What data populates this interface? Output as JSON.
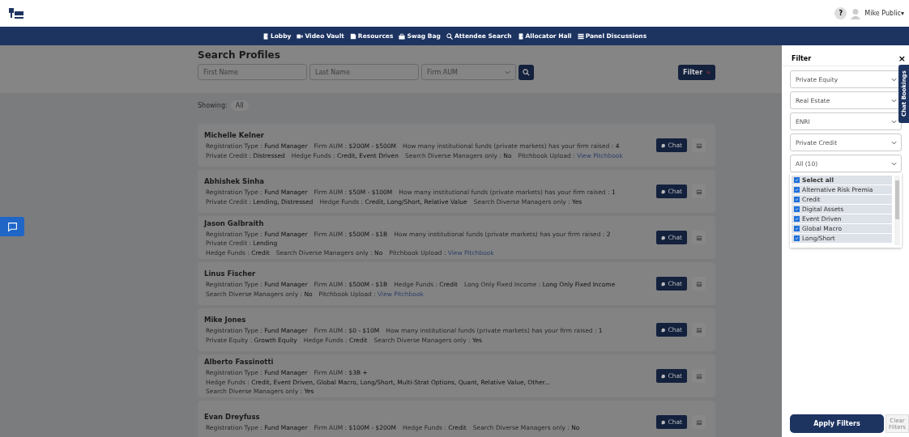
{
  "header": {
    "user_name": "Mike Public▾",
    "help": "?"
  },
  "nav": [
    {
      "label": "Lobby"
    },
    {
      "label": "Video Vault"
    },
    {
      "label": "Resources"
    },
    {
      "label": "Swag Bag"
    },
    {
      "label": "Attendee Search"
    },
    {
      "label": "Allocator Hall"
    },
    {
      "label": "Panel Discussions"
    }
  ],
  "search": {
    "title": "Search Profiles",
    "first_name": {
      "placeholder": "First Name"
    },
    "last_name": {
      "placeholder": "Last Name"
    },
    "firm_aum": {
      "placeholder": "Firm AUM"
    },
    "filter_button": "Filter"
  },
  "showing": {
    "label": "Showing:",
    "chip": "All"
  },
  "profiles": [
    {
      "name": "Michelle Kelner",
      "lines": [
        [
          {
            "label": "Registration Type : ",
            "value": "Fund Manager"
          },
          {
            "label": "Firm AUM : ",
            "value": "$200M - $500M"
          },
          {
            "label": "How many institutional funds (private markets) has your firm raised : ",
            "value": "4"
          }
        ],
        [
          {
            "label": "Private Credit : ",
            "value": "Distressed"
          },
          {
            "label": "Hedge Funds : ",
            "value": "Credit, Event Driven"
          },
          {
            "label": "Search Diverse Managers only : ",
            "value": "No"
          },
          {
            "label": "Pitchbook Upload : ",
            "value": "View Pitchbook",
            "kind": "link"
          }
        ]
      ],
      "chat": "Chat"
    },
    {
      "name": "Abhishek Sinha",
      "lines": [
        [
          {
            "label": "Registration Type : ",
            "value": "Fund Manager"
          },
          {
            "label": "Firm AUM : ",
            "value": "$50M - $100M"
          },
          {
            "label": "How many institutional funds (private markets) has your firm raised : ",
            "value": "1"
          }
        ],
        [
          {
            "label": "Private Credit : ",
            "value": "Lending, Distressed"
          },
          {
            "label": "Hedge Funds : ",
            "value": "Credit, Long/Short, Relative Value"
          },
          {
            "label": "Search Diverse Managers only : ",
            "value": "Yes"
          }
        ]
      ],
      "chat": "Chat"
    },
    {
      "name": "Jason Galbraith",
      "lines": [
        [
          {
            "label": "Registration Type : ",
            "value": "Fund Manager"
          },
          {
            "label": "Firm AUM : ",
            "value": "$500M - $1B"
          },
          {
            "label": "How many institutional funds (private markets) has your firm raised : ",
            "value": "2"
          },
          {
            "label": "Private Credit : ",
            "value": "Lending"
          }
        ],
        [
          {
            "label": "Hedge Funds : ",
            "value": "Credit"
          },
          {
            "label": "Search Diverse Managers only : ",
            "value": "No"
          },
          {
            "label": "Pitchbook Upload : ",
            "value": "View Pitchbook",
            "kind": "link"
          }
        ]
      ],
      "chat": "Chat"
    },
    {
      "name": "Linus Fischer",
      "lines": [
        [
          {
            "label": "Registration Type : ",
            "value": "Fund Manager"
          },
          {
            "label": "Firm AUM : ",
            "value": "$500M - $1B"
          },
          {
            "label": "Hedge Funds : ",
            "value": "Credit"
          },
          {
            "label": "Long Only Fixed Income : ",
            "value": "Long Only Fixed Income"
          }
        ],
        [
          {
            "label": "Search Diverse Managers only : ",
            "value": "No"
          },
          {
            "label": "Pitchbook Upload : ",
            "value": "View Pitchbook",
            "kind": "link"
          }
        ]
      ],
      "chat": "Chat"
    },
    {
      "name": "Mike Jones",
      "lines": [
        [
          {
            "label": "Registration Type : ",
            "value": "Fund Manager"
          },
          {
            "label": "Firm AUM : ",
            "value": "$0 - $10M"
          },
          {
            "label": "How many institutional funds (private markets) has your firm raised : ",
            "value": "1"
          }
        ],
        [
          {
            "label": "Private Equity : ",
            "value": "Growth Equity"
          },
          {
            "label": "Hedge Funds : ",
            "value": "Credit"
          },
          {
            "label": "Search Diverse Managers only : ",
            "value": "Yes"
          }
        ]
      ],
      "chat": "Chat"
    },
    {
      "name": "Alberto Fassinotti",
      "lines": [
        [
          {
            "label": "Registration Type : ",
            "value": "Fund Manager"
          },
          {
            "label": "Firm AUM : ",
            "value": "$3B +"
          }
        ],
        [
          {
            "label": "Hedge Funds : ",
            "value": "Credit, Event Driven, Global Macro, Long/Short, Multi-Strat Options, Quant, Relative Value, Other..."
          },
          {
            "label": "Search Diverse Managers only : ",
            "value": "Yes"
          }
        ]
      ],
      "chat": "Chat"
    },
    {
      "name": "Evan Dreyfuss",
      "lines": [
        [
          {
            "label": "Registration Type : ",
            "value": "Fund Manager"
          },
          {
            "label": "Firm AUM : ",
            "value": "$100M - $200M"
          },
          {
            "label": "Hedge Funds : ",
            "value": "Credit"
          },
          {
            "label": "Search Diverse Managers only : ",
            "value": "No"
          }
        ]
      ],
      "chat": "Chat"
    }
  ],
  "filter_panel": {
    "title": "Filter",
    "close": "×",
    "selects": [
      "Private Equity",
      "Real Estate",
      "ENRI",
      "Private Credit",
      "All (10)"
    ],
    "options": [
      {
        "label": "Select all",
        "checked": true,
        "kind": "all"
      },
      {
        "label": "Alternative Risk Premia",
        "checked": true
      },
      {
        "label": "Credit",
        "checked": true
      },
      {
        "label": "Digital Assets",
        "checked": true
      },
      {
        "label": "Event Driven",
        "checked": true
      },
      {
        "label": "Global Macro",
        "checked": true
      },
      {
        "label": "Long/Short",
        "checked": true
      }
    ],
    "apply": "Apply Filters",
    "clear": "Clear Filters"
  },
  "side_tab": "Chat Bookings"
}
